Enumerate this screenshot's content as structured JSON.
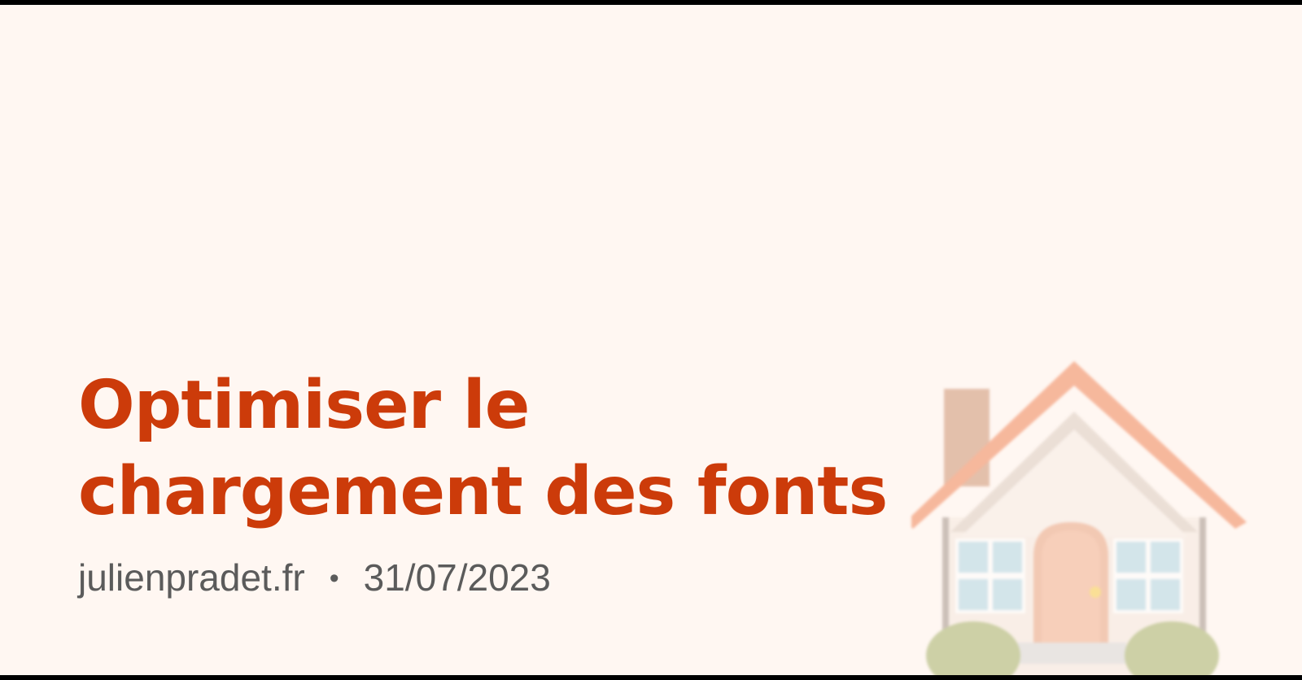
{
  "title": {
    "line1": "Optimiser le",
    "line2": "chargement des fonts"
  },
  "meta": {
    "site": "julienpradet.fr",
    "separator": "•",
    "date": "31/07/2023"
  },
  "colors": {
    "background": "#fff7f2",
    "title": "#cc3b0a",
    "meta": "#5b5b5b"
  },
  "illustration": {
    "icon": "house-icon"
  }
}
